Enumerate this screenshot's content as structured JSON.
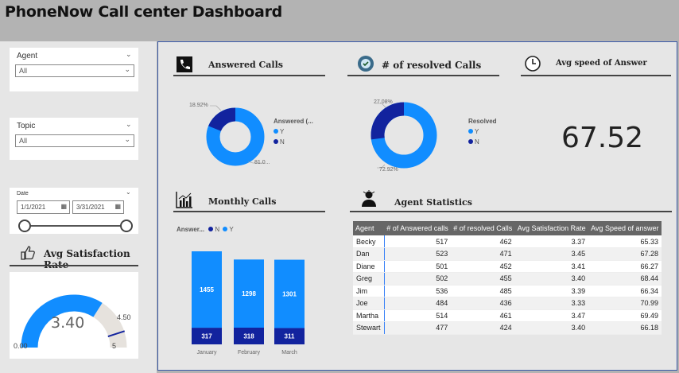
{
  "app": {
    "title": "PhoneNow Call center Dashboard"
  },
  "filters": {
    "agent": {
      "label": "Agent",
      "value": "All"
    },
    "topic": {
      "label": "Topic",
      "value": "All"
    },
    "date": {
      "label": "Date",
      "start": "1/1/2021",
      "end": "3/31/2021"
    }
  },
  "satisfaction": {
    "title": "Avg Satisfaction Rate",
    "value": "3.40",
    "min": "0.00",
    "max": "5",
    "target": "4.50",
    "value_num": 3.4,
    "max_num": 5,
    "target_num": 4.5,
    "colors": {
      "fill": "#118dff",
      "track": "#e6e2dd",
      "target": "#12239e"
    }
  },
  "answered_calls": {
    "title": "Answered Calls",
    "legend_title": "Answered (...",
    "legend": [
      {
        "label": "Y",
        "color": "#118dff"
      },
      {
        "label": "N",
        "color": "#12239e"
      }
    ],
    "label_small": "18.92%",
    "label_large": "81.0...",
    "n_share": 0.1892
  },
  "resolved_calls": {
    "title": "# of resolved Calls",
    "legend_title": "Resolved",
    "legend": [
      {
        "label": "Y",
        "color": "#118dff"
      },
      {
        "label": "N",
        "color": "#12239e"
      }
    ],
    "label_small": "27.08%",
    "label_large": "72.92%",
    "n_share": 0.2708
  },
  "speed": {
    "title": "Avg speed of Answer",
    "value": "67.52"
  },
  "monthly": {
    "title": "Monthly Calls",
    "legend_title": "Answer...",
    "legend": [
      {
        "label": "N",
        "color": "#12239e"
      },
      {
        "label": "Y",
        "color": "#118dff"
      }
    ]
  },
  "agent_stats": {
    "title": "Agent Statistics",
    "columns": [
      "Agent",
      "# of Answered calls",
      "# of resolved Calls",
      "Avg Satisfaction Rate",
      "Avg Speed of answer"
    ],
    "rows": [
      [
        "Becky",
        "517",
        "462",
        "3.37",
        "65.33"
      ],
      [
        "Dan",
        "523",
        "471",
        "3.45",
        "67.28"
      ],
      [
        "Diane",
        "501",
        "452",
        "3.41",
        "66.27"
      ],
      [
        "Greg",
        "502",
        "455",
        "3.40",
        "68.44"
      ],
      [
        "Jim",
        "536",
        "485",
        "3.39",
        "66.34"
      ],
      [
        "Joe",
        "484",
        "436",
        "3.33",
        "70.99"
      ],
      [
        "Martha",
        "514",
        "461",
        "3.47",
        "69.49"
      ],
      [
        "Stewart",
        "477",
        "424",
        "3.40",
        "66.18"
      ]
    ]
  },
  "chart_data": [
    {
      "type": "pie",
      "title": "Answered Calls",
      "categories": [
        "Y",
        "N"
      ],
      "values": [
        81.08,
        18.92
      ]
    },
    {
      "type": "pie",
      "title": "# of resolved Calls",
      "categories": [
        "Y",
        "N"
      ],
      "values": [
        72.92,
        27.08
      ]
    },
    {
      "type": "bar",
      "title": "Monthly Calls",
      "categories": [
        "January",
        "February",
        "March"
      ],
      "stacked": true,
      "series": [
        {
          "name": "N",
          "values": [
            317,
            318,
            311
          ],
          "color": "#12239e"
        },
        {
          "name": "Y",
          "values": [
            1455,
            1298,
            1301
          ],
          "color": "#118dff"
        }
      ]
    }
  ]
}
